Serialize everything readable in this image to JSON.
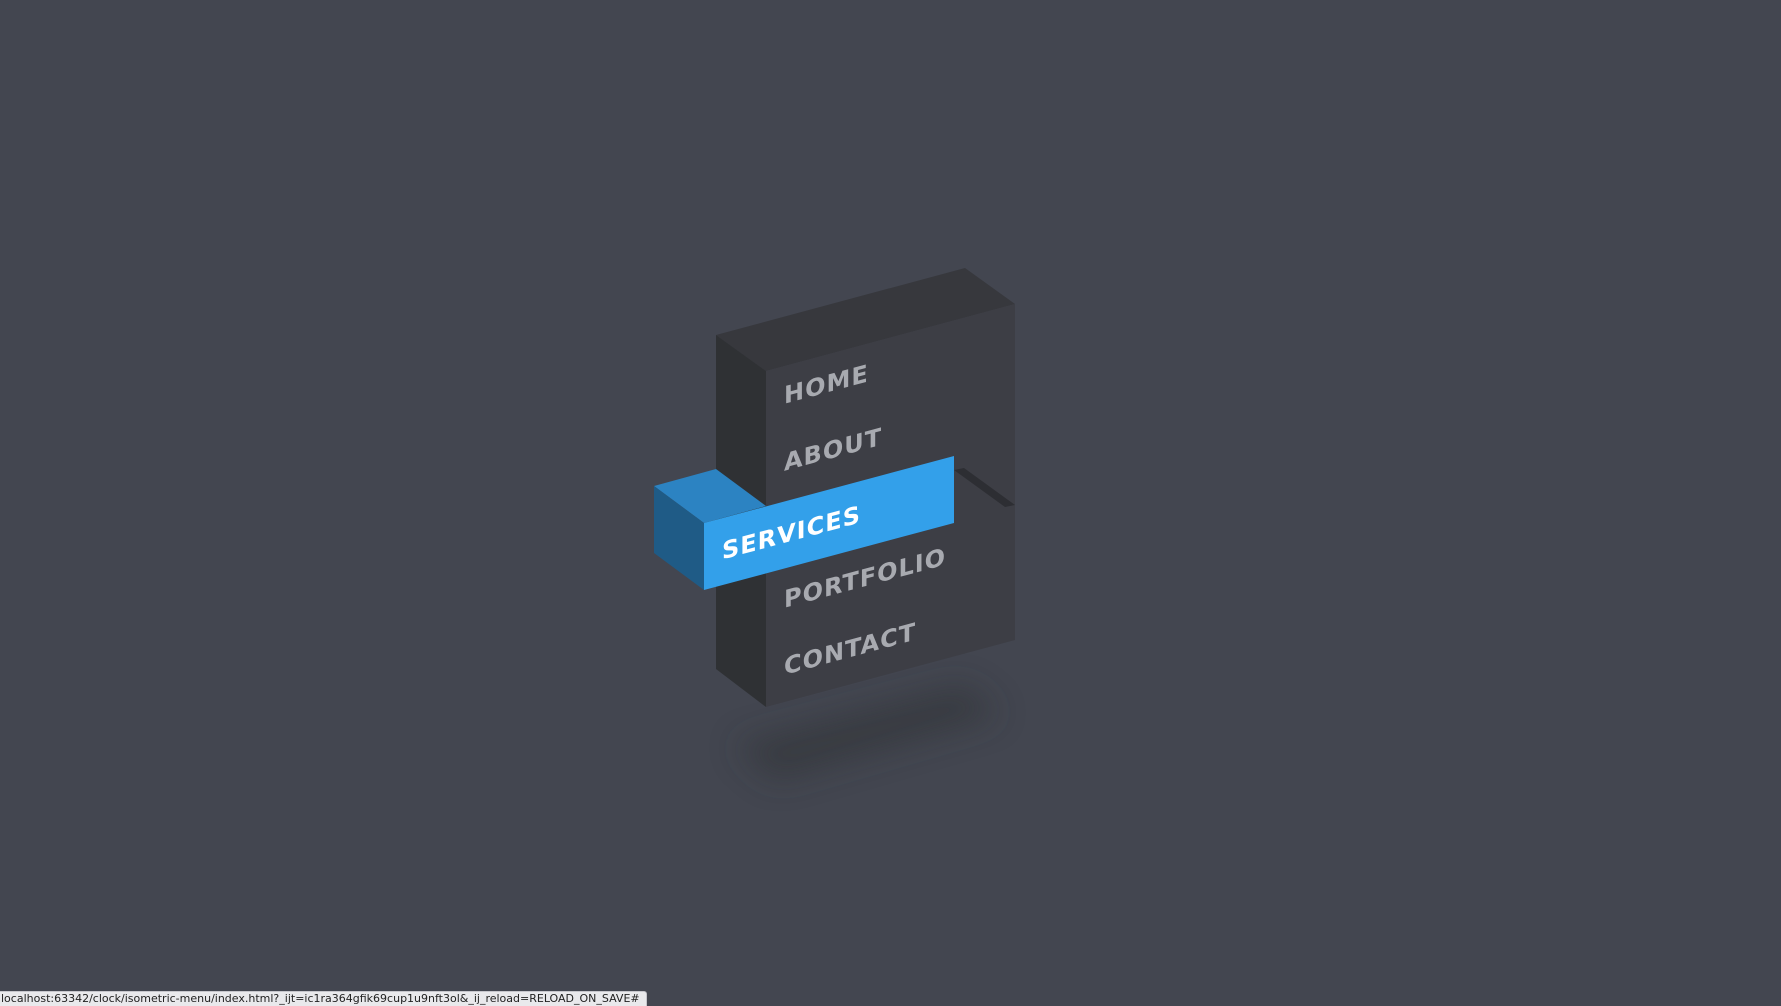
{
  "menu": {
    "items": [
      {
        "id": "home",
        "label": "HOME",
        "active": false
      },
      {
        "id": "about",
        "label": "ABOUT",
        "active": false
      },
      {
        "id": "services",
        "label": "SERVICES",
        "active": true
      },
      {
        "id": "portfolio",
        "label": "PORTFOLIO",
        "active": false
      },
      {
        "id": "contact",
        "label": "CONTACT",
        "active": false
      }
    ]
  },
  "status_bar": {
    "url": "localhost:63342/clock/isometric-menu/index.html?_ijt=ic1ra364gfik69cup1u9nft3ol&_ij_reload=RELOAD_ON_SAVE#"
  },
  "colors": {
    "background": "#434650",
    "block_top": "#37383d",
    "block_left": "#2f3134",
    "block_front": "#3d3e45",
    "text_inactive": "#a8aab0",
    "text_active": "#ffffff",
    "accent_front": "#33a0ea",
    "accent_top": "#2c83c2",
    "accent_side": "#1f5b86"
  }
}
